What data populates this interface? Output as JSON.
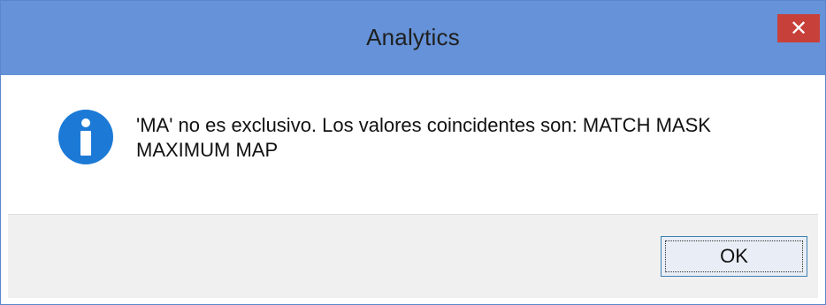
{
  "window": {
    "title": "Analytics",
    "close_glyph": "✕"
  },
  "message": {
    "icon": "info-icon",
    "line1": "'MA' no es exclusivo. Los valores coincidentes son:  MATCH MASK",
    "line2": "MAXIMUM MAP"
  },
  "buttons": {
    "ok_label": "OK"
  },
  "colors": {
    "titlebar": "#6592d8",
    "close_button": "#c7403a",
    "info_icon": "#1c7ad6"
  }
}
